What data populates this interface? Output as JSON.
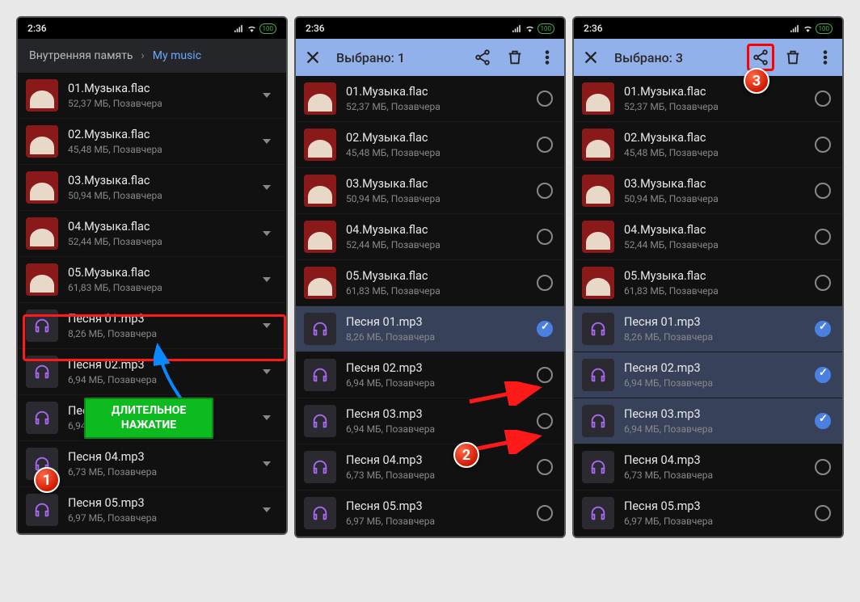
{
  "status": {
    "time": "2:36",
    "battery": "100"
  },
  "screen1": {
    "breadcrumb": {
      "root": "Внутренняя память",
      "current": "My music"
    },
    "callout": "ДЛИТЕЛЬНОЕ\nНАЖАТИЕ",
    "files": [
      {
        "name": "01.Музыка.flac",
        "meta": "52,37 МБ, Позавчера",
        "type": "album"
      },
      {
        "name": "02.Музыка.flac",
        "meta": "45,48 МБ, Позавчера",
        "type": "album"
      },
      {
        "name": "03.Музыка.flac",
        "meta": "50,94 МБ, Позавчера",
        "type": "album"
      },
      {
        "name": "04.Музыка.flac",
        "meta": "52,44 МБ, Позавчера",
        "type": "album"
      },
      {
        "name": "05.Музыка.flac",
        "meta": "61,83 МБ, Позавчера",
        "type": "album"
      },
      {
        "name": "Песня 01.mp3",
        "meta": "8,26 МБ, Позавчера",
        "type": "audio"
      },
      {
        "name": "Песня 02.mp3",
        "meta": "6,94 МБ, Позавчера",
        "type": "audio"
      },
      {
        "name": "Песня 03.mp3",
        "meta": "6,94 МБ, Позавчера",
        "type": "audio"
      },
      {
        "name": "Песня 04.mp3",
        "meta": "6,73 МБ, Позавчера",
        "type": "audio"
      },
      {
        "name": "Песня 05.mp3",
        "meta": "6,97 МБ, Позавчера",
        "type": "audio"
      }
    ]
  },
  "screen2": {
    "title": "Выбрано: 1",
    "files": [
      {
        "name": "01.Музыка.flac",
        "meta": "52,37 МБ, Позавчера",
        "type": "album",
        "selected": false
      },
      {
        "name": "02.Музыка.flac",
        "meta": "45,48 МБ, Позавчера",
        "type": "album",
        "selected": false
      },
      {
        "name": "03.Музыка.flac",
        "meta": "50,94 МБ, Позавчера",
        "type": "album",
        "selected": false
      },
      {
        "name": "04.Музыка.flac",
        "meta": "52,44 МБ, Позавчера",
        "type": "album",
        "selected": false
      },
      {
        "name": "05.Музыка.flac",
        "meta": "61,83 МБ, Позавчера",
        "type": "album",
        "selected": false
      },
      {
        "name": "Песня 01.mp3",
        "meta": "8,26 МБ, Позавчера",
        "type": "audio",
        "selected": true
      },
      {
        "name": "Песня 02.mp3",
        "meta": "6,94 МБ, Позавчера",
        "type": "audio",
        "selected": false
      },
      {
        "name": "Песня 03.mp3",
        "meta": "6,94 МБ, Позавчера",
        "type": "audio",
        "selected": false
      },
      {
        "name": "Песня 04.mp3",
        "meta": "6,73 МБ, Позавчера",
        "type": "audio",
        "selected": false
      },
      {
        "name": "Песня 05.mp3",
        "meta": "6,97 МБ, Позавчера",
        "type": "audio",
        "selected": false
      }
    ]
  },
  "screen3": {
    "title": "Выбрано: 3",
    "files": [
      {
        "name": "01.Музыка.flac",
        "meta": "52,37 МБ, Позавчера",
        "type": "album",
        "selected": false
      },
      {
        "name": "02.Музыка.flac",
        "meta": "45,48 МБ, Позавчера",
        "type": "album",
        "selected": false
      },
      {
        "name": "03.Музыка.flac",
        "meta": "50,94 МБ, Позавчера",
        "type": "album",
        "selected": false
      },
      {
        "name": "04.Музыка.flac",
        "meta": "52,44 МБ, Позавчера",
        "type": "album",
        "selected": false
      },
      {
        "name": "05.Музыка.flac",
        "meta": "61,83 МБ, Позавчера",
        "type": "album",
        "selected": false
      },
      {
        "name": "Песня 01.mp3",
        "meta": "8,26 МБ, Позавчера",
        "type": "audio",
        "selected": true
      },
      {
        "name": "Песня 02.mp3",
        "meta": "6,94 МБ, Позавчера",
        "type": "audio",
        "selected": true
      },
      {
        "name": "Песня 03.mp3",
        "meta": "6,94 МБ, Позавчера",
        "type": "audio",
        "selected": true
      },
      {
        "name": "Песня 04.mp3",
        "meta": "6,73 МБ, Позавчера",
        "type": "audio",
        "selected": false
      },
      {
        "name": "Песня 05.mp3",
        "meta": "6,97 МБ, Позавчера",
        "type": "audio",
        "selected": false
      }
    ]
  },
  "badges": {
    "b1": "1",
    "b2": "2",
    "b3": "3"
  }
}
